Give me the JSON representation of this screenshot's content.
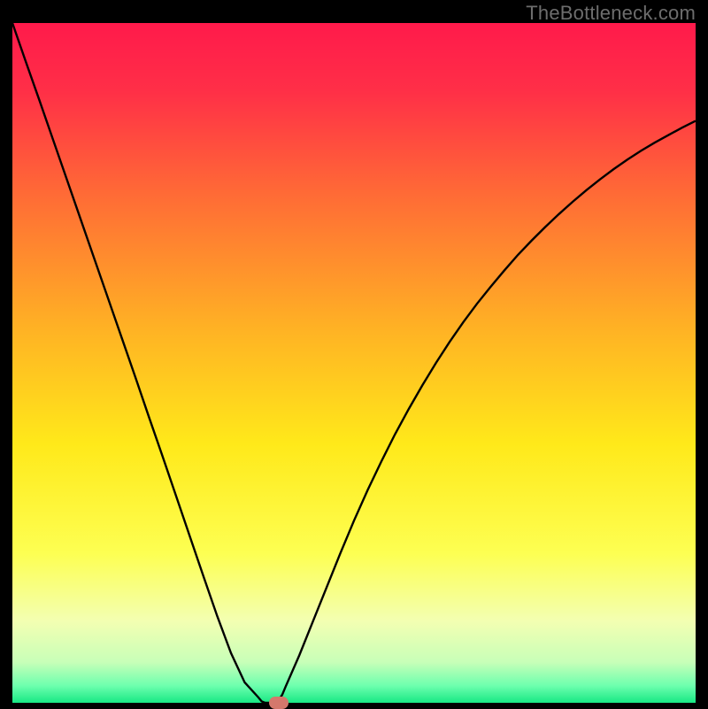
{
  "watermark": "TheBottleneck.com",
  "colors": {
    "gradient_stops": [
      {
        "offset": 0.0,
        "color": "#ff1a4b"
      },
      {
        "offset": 0.1,
        "color": "#ff2f47"
      },
      {
        "offset": 0.25,
        "color": "#ff6a36"
      },
      {
        "offset": 0.45,
        "color": "#ffb224"
      },
      {
        "offset": 0.62,
        "color": "#ffe91a"
      },
      {
        "offset": 0.78,
        "color": "#fdff52"
      },
      {
        "offset": 0.88,
        "color": "#f3ffb2"
      },
      {
        "offset": 0.94,
        "color": "#c8ffb8"
      },
      {
        "offset": 0.975,
        "color": "#6dffae"
      },
      {
        "offset": 1.0,
        "color": "#18e884"
      }
    ],
    "curve": "#000000",
    "marker": "#d4786c",
    "frame": "#000000"
  },
  "chart_data": {
    "type": "line",
    "title": "",
    "xlabel": "",
    "ylabel": "",
    "x": [
      0.0,
      0.02,
      0.04,
      0.06,
      0.08,
      0.1,
      0.12,
      0.14,
      0.16,
      0.18,
      0.2,
      0.22,
      0.24,
      0.26,
      0.28,
      0.3,
      0.32,
      0.34,
      0.36,
      0.365,
      0.37,
      0.375,
      0.38,
      0.385,
      0.39,
      0.395,
      0.4,
      0.42,
      0.44,
      0.46,
      0.48,
      0.5,
      0.52,
      0.54,
      0.56,
      0.58,
      0.6,
      0.62,
      0.64,
      0.66,
      0.68,
      0.7,
      0.72,
      0.74,
      0.76,
      0.78,
      0.8,
      0.82,
      0.84,
      0.86,
      0.88,
      0.9,
      0.92,
      0.94,
      0.96,
      0.98,
      1.0
    ],
    "values": [
      100.0,
      94.2,
      88.5,
      82.7,
      76.9,
      71.1,
      65.3,
      59.5,
      53.7,
      47.9,
      42.0,
      36.2,
      30.3,
      24.4,
      18.5,
      12.7,
      7.3,
      3.0,
      0.8,
      0.2,
      0.0,
      0.0,
      0.0,
      0.0,
      0.4,
      1.2,
      2.4,
      7.0,
      12.0,
      17.0,
      22.0,
      26.8,
      31.3,
      35.5,
      39.5,
      43.2,
      46.7,
      50.0,
      53.1,
      56.0,
      58.7,
      61.2,
      63.6,
      65.9,
      68.0,
      70.0,
      71.9,
      73.7,
      75.4,
      77.0,
      78.5,
      79.9,
      81.2,
      82.4,
      83.5,
      84.6,
      85.6
    ],
    "xlim": [
      0,
      1
    ],
    "ylim": [
      0,
      100
    ],
    "marker_x": 0.39,
    "marker_y": 0.0
  }
}
